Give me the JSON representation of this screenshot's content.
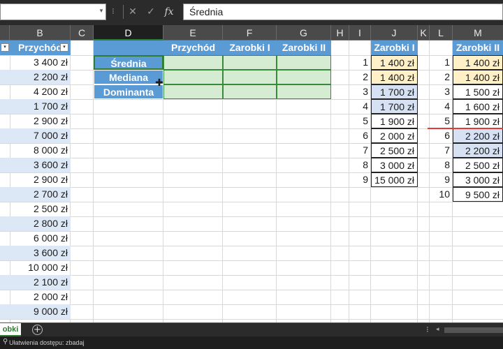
{
  "formula_bar": {
    "cancel_icon": "✕",
    "confirm_icon": "✓",
    "fx_label": "fx",
    "formula": "Średnia"
  },
  "columns": [
    "B",
    "C",
    "D",
    "E",
    "F",
    "G",
    "H",
    "I",
    "J",
    "K",
    "L",
    "M"
  ],
  "selected_column": "D",
  "column_b": {
    "header": "Przychód",
    "values": [
      "3 400 zł",
      "2 200 zł",
      "4 200 zł",
      "1 700 zł",
      "2 900 zł",
      "7 000 zł",
      "8 000 zł",
      "3 600 zł",
      "2 900 zł",
      "2 700 zł",
      "2 500 zł",
      "2 800 zł",
      "6 000 zł",
      "3 600 zł",
      "10 000 zł",
      "2 100 zł",
      "2 000 zł",
      "9 000 zł"
    ]
  },
  "stats_table": {
    "headers": [
      "Przychód",
      "Zarobki I",
      "Zarobki II"
    ],
    "rows": [
      "Średnia",
      "Mediana",
      "Dominanta"
    ]
  },
  "zarobki_i": {
    "header": "Zarobki I",
    "indices": [
      "1",
      "2",
      "3",
      "4",
      "5",
      "6",
      "7",
      "8",
      "9"
    ],
    "values": [
      "1 400 zł",
      "1 400 zł",
      "1 700 zł",
      "1 700 zł",
      "1 900 zł",
      "2 000 zł",
      "2 500 zł",
      "3 000 zł",
      "15 000 zł"
    ]
  },
  "zarobki_ii": {
    "header": "Zarobki II",
    "indices": [
      "1",
      "2",
      "3",
      "4",
      "5",
      "6",
      "7",
      "8",
      "9",
      "10"
    ],
    "values": [
      "1 400 zł",
      "1 400 zł",
      "1 500 zł",
      "1 600 zł",
      "1 900 zł",
      "2 200 zł",
      "2 200 zł",
      "2 500 zł",
      "3 000 zł",
      "9 500 zł"
    ]
  },
  "sheet_tab": {
    "label": "obki"
  },
  "add_sheet_icon": "+",
  "status_bar": {
    "text": "Ułatwienia dostępu: zbadaj"
  },
  "colors": {
    "header_blue": "#5b9bd5",
    "stripe_blue": "#dde8f6",
    "green_fill": "#d5ecd2",
    "yellow_fill": "#fff0c8",
    "median_line": "#e53935",
    "tab_green": "#2e7d32"
  }
}
